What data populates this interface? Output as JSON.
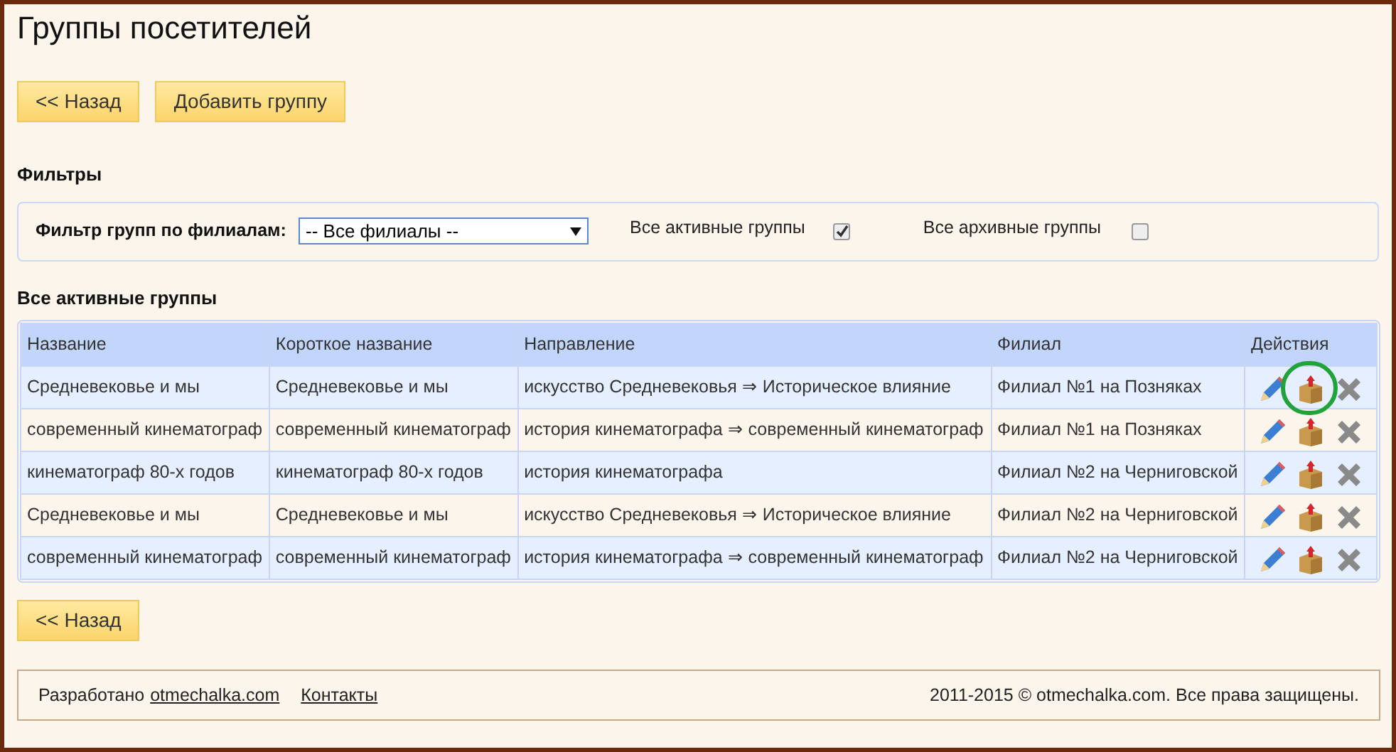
{
  "title": "Группы посетителей",
  "top_buttons": [
    "<< Назад",
    "Добавить группу"
  ],
  "filters": {
    "heading": "Фильтры",
    "branch_label": "Фильтр групп по филиалам:",
    "branch_value": "-- Все филиалы --",
    "checkboxes": [
      {
        "label": "Все активные группы",
        "checked": true
      },
      {
        "label": "Все архивные группы",
        "checked": false
      }
    ]
  },
  "table": {
    "heading": "Все активные группы",
    "columns": [
      "Название",
      "Короткое название",
      "Направление",
      "Филиал",
      "Действия"
    ],
    "rows": [
      {
        "name": "Средневековье и мы",
        "short_name": "Средневековье и мы",
        "direction": "искусство Средневековья ⇒ Историческое влияние",
        "branch": "Филиал №1 на Позняках",
        "highlighted": true
      },
      {
        "name": "современный кинематограф",
        "short_name": "современный кинематограф",
        "direction": "история кинематографа ⇒ современный кинематограф",
        "branch": "Филиал №1 на Позняках",
        "highlighted": false
      },
      {
        "name": "кинематограф 80-х годов",
        "short_name": "кинематограф 80-х годов",
        "direction": "история кинематографа",
        "branch": "Филиал №2 на Черниговской",
        "highlighted": false
      },
      {
        "name": "Средневековье и мы",
        "short_name": "Средневековье и мы",
        "direction": "искусство Средневековья ⇒ Историческое влияние",
        "branch": "Филиал №2 на Черниговской",
        "highlighted": false
      },
      {
        "name": "современный кинематограф",
        "short_name": "современный кинематограф",
        "direction": "история кинематографа ⇒ современный кинематограф",
        "branch": "Филиал №2 на Черниговской",
        "highlighted": false
      }
    ]
  },
  "bottom_button": "<< Назад",
  "footer": {
    "developed": "Разработано",
    "site_link": "otmechalka.com",
    "contacts": "Контакты",
    "copyright": "2011-2015 © otmechalka.com. Все права защищены."
  }
}
